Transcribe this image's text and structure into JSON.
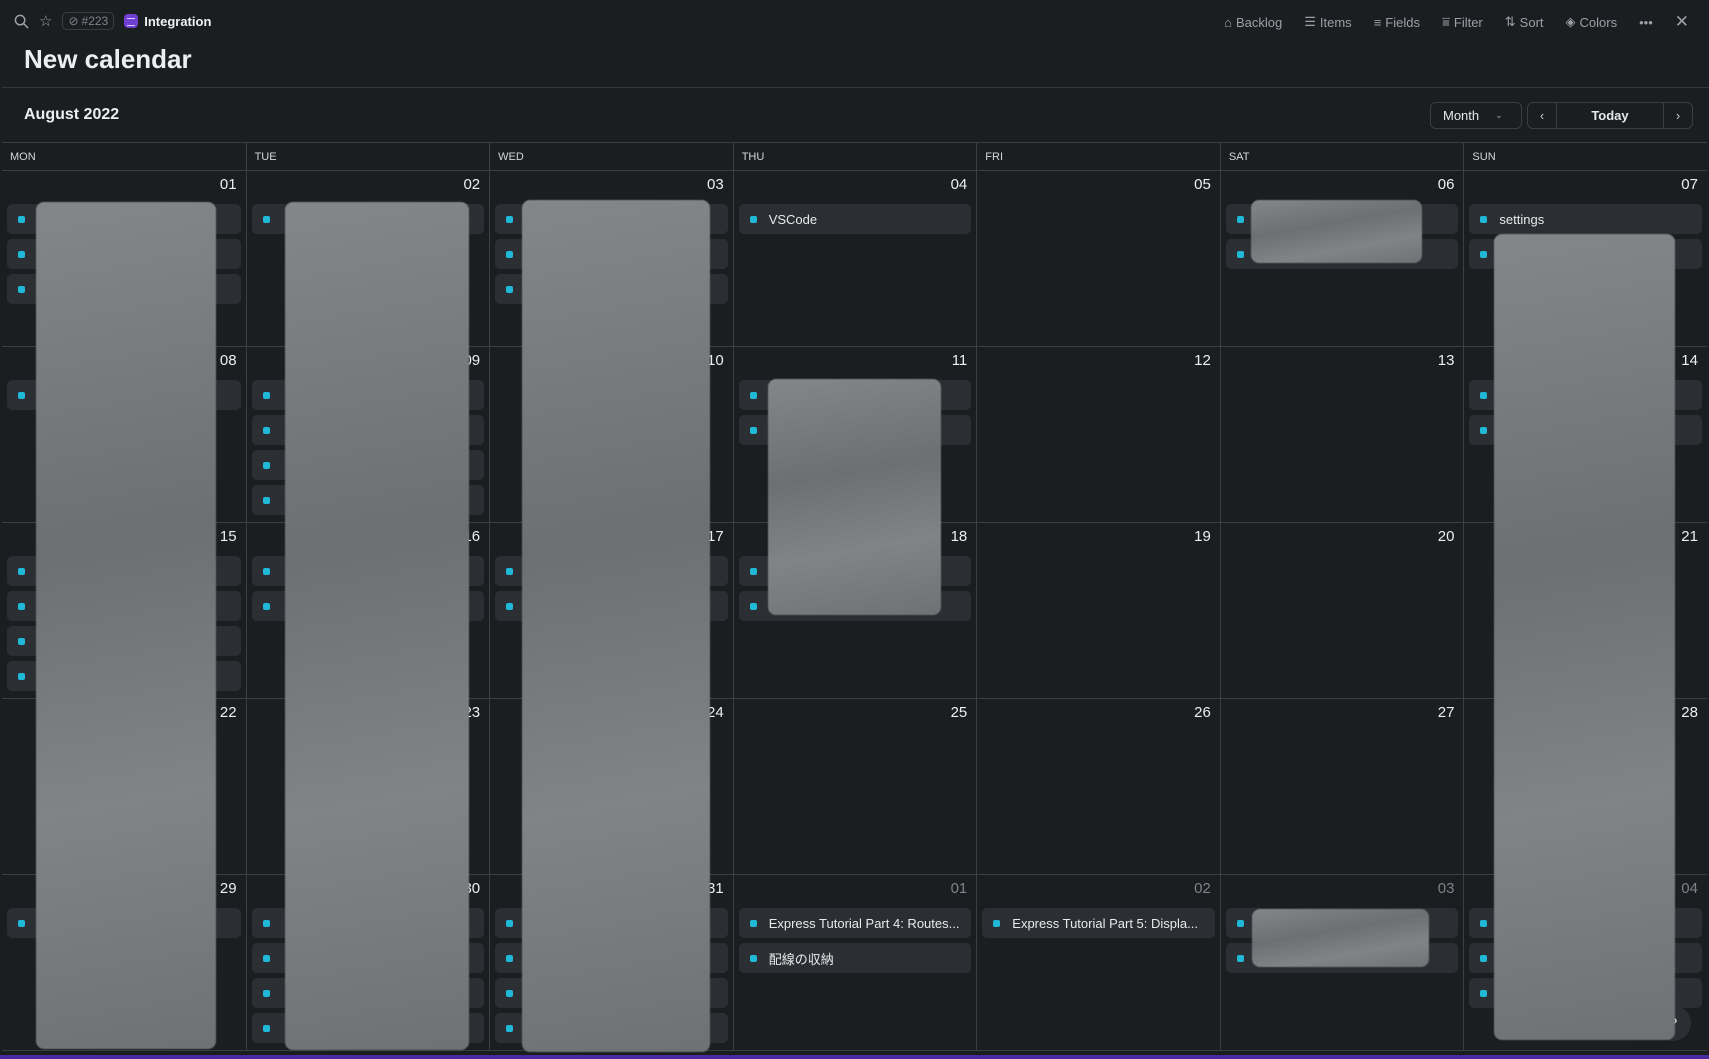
{
  "topbar": {
    "ref": "#223",
    "project": "Integration",
    "actions": [
      {
        "icon": "inbox-icon",
        "label": "Backlog"
      },
      {
        "icon": "items-icon",
        "label": "Items"
      },
      {
        "icon": "fields-icon",
        "label": "Fields"
      },
      {
        "icon": "filter-icon",
        "label": "Filter"
      },
      {
        "icon": "sort-icon",
        "label": "Sort"
      },
      {
        "icon": "paint-bucket-icon",
        "label": "Colors"
      }
    ]
  },
  "title": "New calendar",
  "calendar": {
    "month_label": "August 2022",
    "view": "Month",
    "today_label": "Today",
    "accent": "#1fb8d6",
    "weekdays": [
      "MON",
      "TUE",
      "WED",
      "THU",
      "FRI",
      "SAT",
      "SUN"
    ],
    "weeks": [
      [
        {
          "d": "01",
          "ev": [
            "",
            "",
            ""
          ]
        },
        {
          "d": "02",
          "ev": [
            ""
          ]
        },
        {
          "d": "03",
          "ev": [
            "",
            "",
            ""
          ]
        },
        {
          "d": "04",
          "ev": [
            "VSCode"
          ]
        },
        {
          "d": "05",
          "ev": []
        },
        {
          "d": "06",
          "ev": [
            "",
            ""
          ]
        },
        {
          "d": "07",
          "ev": [
            "settings",
            ""
          ]
        }
      ],
      [
        {
          "d": "08",
          "ev": [
            ""
          ]
        },
        {
          "d": "09",
          "ev": [
            "",
            "",
            "",
            ""
          ]
        },
        {
          "d": "10",
          "ev": []
        },
        {
          "d": "11",
          "ev": [
            "",
            ""
          ]
        },
        {
          "d": "12",
          "ev": []
        },
        {
          "d": "13",
          "ev": []
        },
        {
          "d": "14",
          "ev": [
            "",
            ""
          ]
        }
      ],
      [
        {
          "d": "15",
          "ev": [
            "",
            "",
            "",
            ""
          ]
        },
        {
          "d": "16",
          "ev": [
            "",
            ""
          ]
        },
        {
          "d": "17",
          "ev": [
            "",
            ""
          ]
        },
        {
          "d": "18",
          "ev": [
            "",
            ""
          ]
        },
        {
          "d": "19",
          "ev": []
        },
        {
          "d": "20",
          "ev": []
        },
        {
          "d": "21",
          "ev": []
        }
      ],
      [
        {
          "d": "22",
          "ev": []
        },
        {
          "d": "23",
          "ev": []
        },
        {
          "d": "24",
          "ev": []
        },
        {
          "d": "25",
          "ev": []
        },
        {
          "d": "26",
          "ev": []
        },
        {
          "d": "27",
          "ev": []
        },
        {
          "d": "28",
          "ev": []
        }
      ],
      [
        {
          "d": "29",
          "ev": [
            ""
          ]
        },
        {
          "d": "30",
          "ev": [
            "",
            "",
            "",
            ""
          ]
        },
        {
          "d": "31",
          "ev": [
            "",
            "",
            "",
            ""
          ]
        },
        {
          "d": "01",
          "out": true,
          "ev": [
            "Express Tutorial Part 4: Routes...",
            "配線の収納"
          ]
        },
        {
          "d": "02",
          "out": true,
          "ev": [
            "Express Tutorial Part 5: Displa..."
          ]
        },
        {
          "d": "03",
          "out": true,
          "ev": [
            "",
            ""
          ]
        },
        {
          "d": "04",
          "out": true,
          "ev": [
            "",
            "",
            ""
          ]
        }
      ]
    ]
  },
  "help_label": "?"
}
